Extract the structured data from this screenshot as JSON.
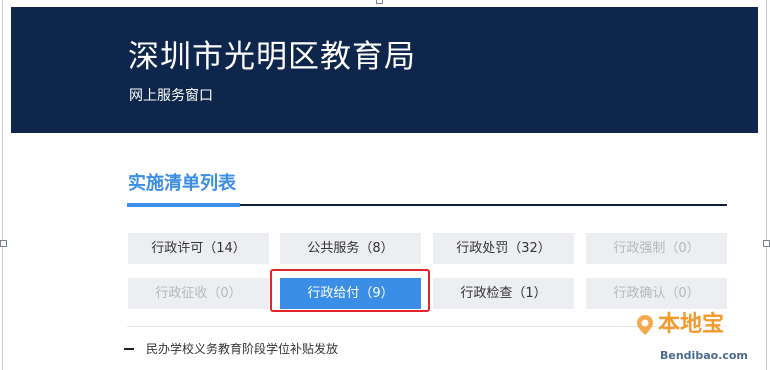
{
  "header": {
    "title": "深圳市光明区教育局",
    "subtitle": "网上服务窗口",
    "background": "#0e264b"
  },
  "section": {
    "title": "实施清单列表",
    "accent": "#3a8ee6"
  },
  "categories": [
    {
      "label": "行政许可（14）",
      "state": "normal"
    },
    {
      "label": "公共服务（8）",
      "state": "normal"
    },
    {
      "label": "行政处罚（32）",
      "state": "normal"
    },
    {
      "label": "行政强制（0）",
      "state": "disabled"
    },
    {
      "label": "行政征收（0）",
      "state": "disabled"
    },
    {
      "label": "行政给付（9）",
      "state": "active"
    },
    {
      "label": "行政检查（1）",
      "state": "normal"
    },
    {
      "label": "行政确认（0）",
      "state": "disabled"
    }
  ],
  "highlight_color": "#e0262a",
  "list": {
    "items": [
      "民办学校义务教育阶段学位补贴发放"
    ]
  },
  "watermark": {
    "logo_text": "本地宝",
    "url": "Bendibao.com",
    "icon": "location-pin-icon"
  }
}
